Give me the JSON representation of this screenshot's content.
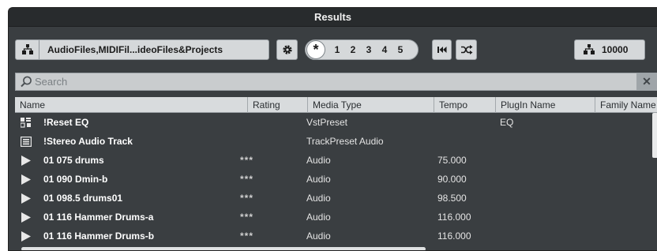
{
  "window": {
    "title": "Results"
  },
  "toolbar": {
    "location_label": "AudioFiles,MIDIFil...ideoFiles&Projects",
    "preset_star": "*",
    "preset_slots": [
      "1",
      "2",
      "3",
      "4",
      "5"
    ],
    "result_count": "10000"
  },
  "search": {
    "placeholder": "Search"
  },
  "columns": [
    "Name",
    "Rating",
    "Media Type",
    "Tempo",
    "PlugIn Name",
    "Family Name"
  ],
  "rows": [
    {
      "icon": "preset-icon",
      "name": "!Reset EQ",
      "rating": "",
      "media_type": "VstPreset",
      "tempo": "",
      "plugin": "EQ"
    },
    {
      "icon": "track-preset-icon",
      "name": "!Stereo Audio Track",
      "rating": "",
      "media_type": "TrackPreset Audio",
      "tempo": "",
      "plugin": ""
    },
    {
      "icon": "play-icon",
      "name": "01 075 drums",
      "rating": "***",
      "media_type": "Audio",
      "tempo": "75.000",
      "plugin": ""
    },
    {
      "icon": "play-icon",
      "name": "01 090 Dmin-b",
      "rating": "***",
      "media_type": "Audio",
      "tempo": "90.000",
      "plugin": ""
    },
    {
      "icon": "play-icon",
      "name": "01 098.5 drums01",
      "rating": "***",
      "media_type": "Audio",
      "tempo": "98.500",
      "plugin": ""
    },
    {
      "icon": "play-icon",
      "name": "01 116 Hammer Drums-a",
      "rating": "***",
      "media_type": "Audio",
      "tempo": "116.000",
      "plugin": ""
    },
    {
      "icon": "play-icon",
      "name": "01 116 Hammer Drums-b",
      "rating": "***",
      "media_type": "Audio",
      "tempo": "116.000",
      "plugin": ""
    }
  ]
}
